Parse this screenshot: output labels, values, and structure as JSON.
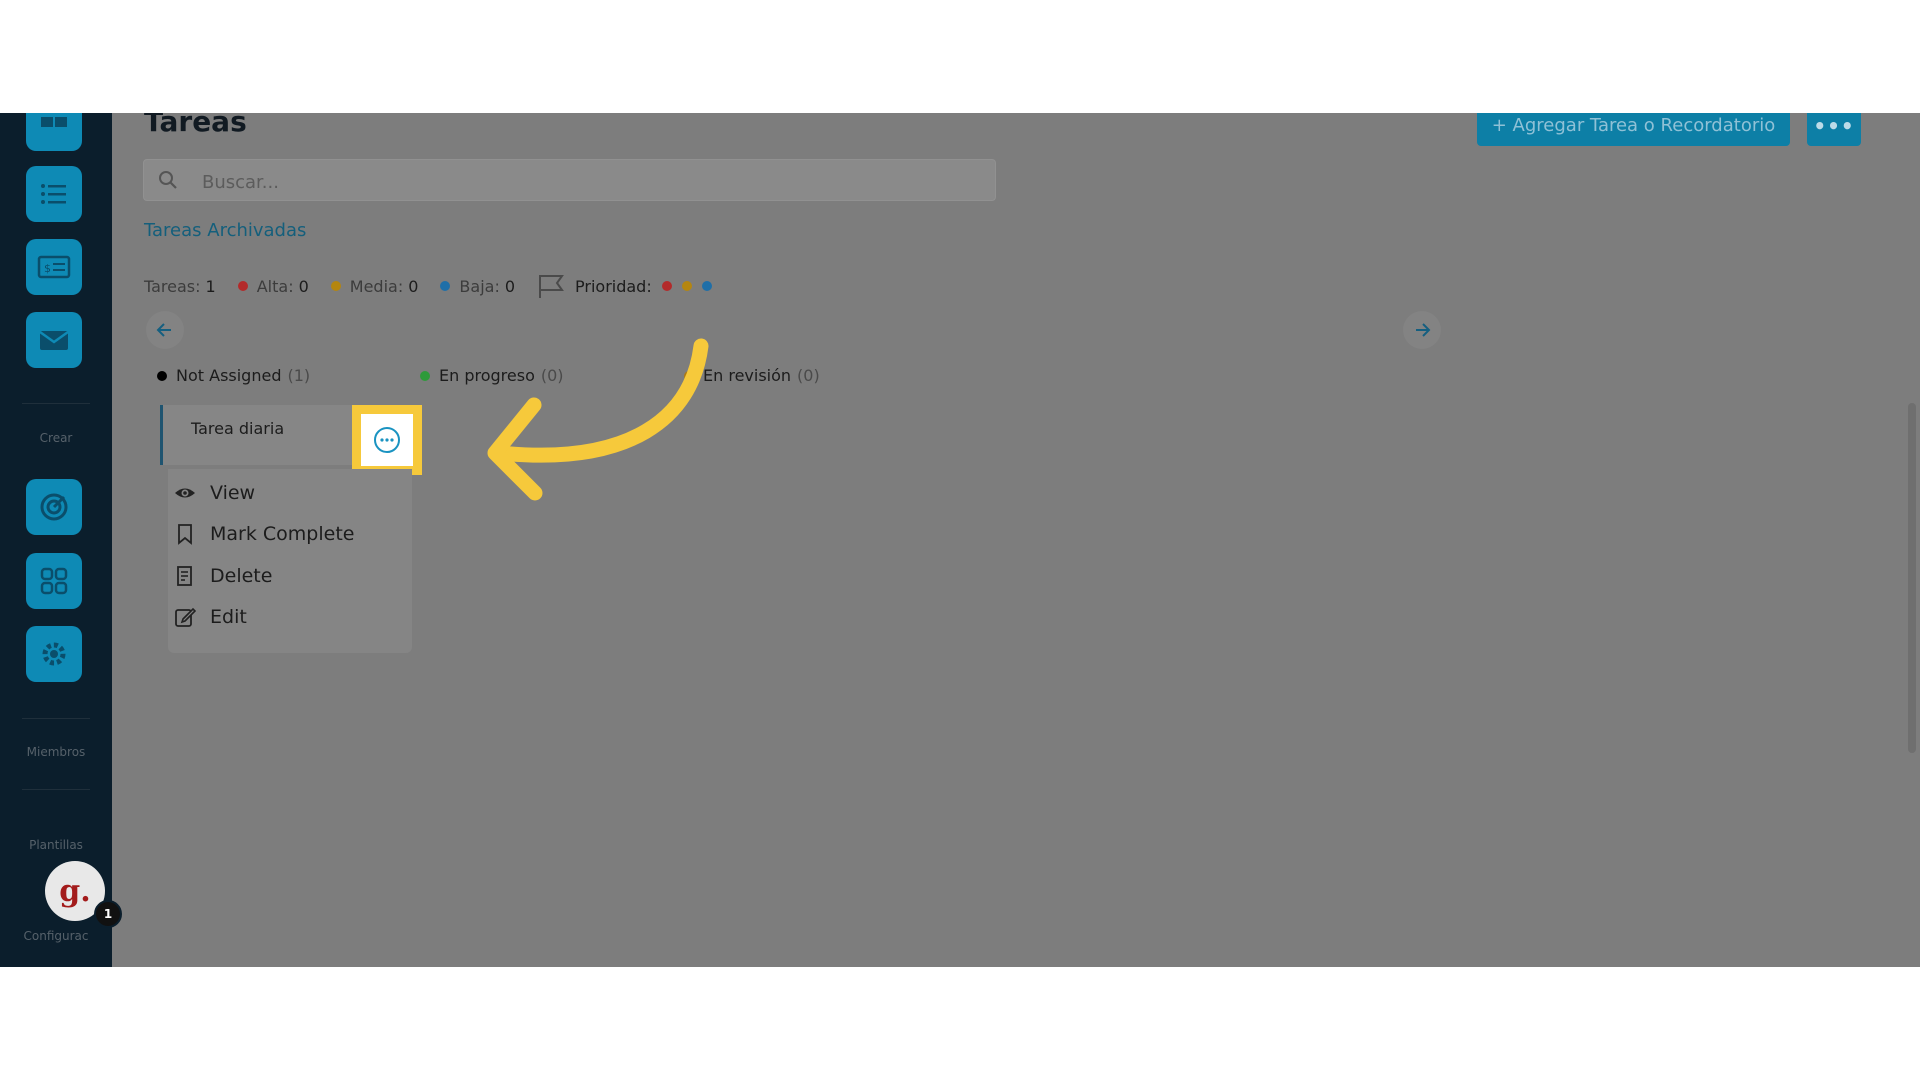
{
  "sidebar": {
    "labels": {
      "crear": "Crear",
      "miembros": "Miembros",
      "plantillas": "Plantillas",
      "configuracion": "Configurac"
    },
    "avatar_letter": "g.",
    "notification_count": "1"
  },
  "header": {
    "title": "Tareas",
    "add_button": "+ Agregar Tarea o Recordatorio",
    "more_button": "•••"
  },
  "search": {
    "placeholder": "Buscar..."
  },
  "archived_link": "Tareas Archivadas",
  "stats": {
    "tareas_label": "Tareas:",
    "tareas_value": "1",
    "alta_label": "Alta:",
    "alta_value": "0",
    "media_label": "Media:",
    "media_value": "0",
    "baja_label": "Baja:",
    "baja_value": "0",
    "prioridad_label": "Prioridad:"
  },
  "columns": [
    {
      "label": "Not Assigned",
      "count": "(1)",
      "color": "#000000"
    },
    {
      "label": "En progreso",
      "count": "(0)",
      "color": "#2e9a3a"
    },
    {
      "label": "En revisión",
      "count": "(0)",
      "color": "#b07a10"
    }
  ],
  "card": {
    "title": "Tarea diaria"
  },
  "context_menu": [
    {
      "label": "View",
      "icon": "eye-icon"
    },
    {
      "label": "Mark Complete",
      "icon": "bookmark-icon"
    },
    {
      "label": "Delete",
      "icon": "receipt-icon"
    },
    {
      "label": "Edit",
      "icon": "edit-icon"
    }
  ],
  "colors": {
    "overlay": "#7d7d7d",
    "sidebar": "#0b1e2c",
    "accent": "#0d7fa6",
    "highlight": "#f6c93b",
    "alta": "#b32a2a",
    "media": "#b5860f",
    "baja": "#1f6fa8"
  }
}
